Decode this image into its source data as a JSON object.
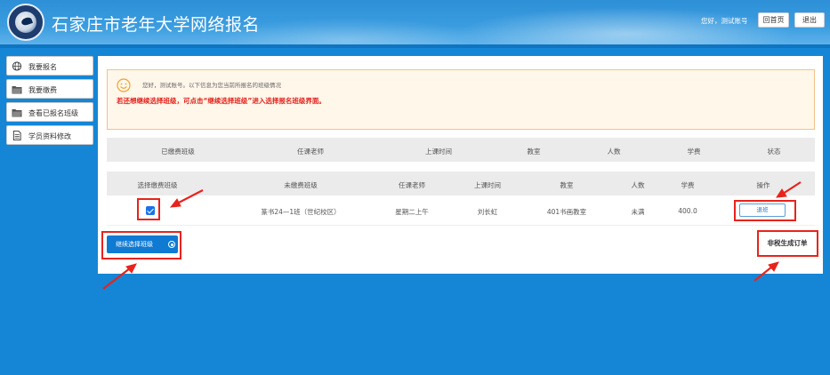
{
  "header": {
    "site_title": "石家庄市老年大学网络报名",
    "greeting": "您好，测试账号",
    "home_label": "回首页",
    "exit_label": "退出"
  },
  "sidebar": {
    "items": [
      {
        "label": "我要报名",
        "icon": "globe-icon"
      },
      {
        "label": "我要缴费",
        "icon": "folder-icon"
      },
      {
        "label": "查看已报名班级",
        "icon": "folder-icon"
      },
      {
        "label": "学员资料修改",
        "icon": "document-icon"
      }
    ]
  },
  "notice": {
    "line1": "您好，测试账号。以下信息为您当前所报名的班级情况",
    "line2": "若还想继续选择班级，可点击“继续选择班级”进入选择报名班级界面。"
  },
  "paid_table": {
    "headers": [
      "已缴费班级",
      "任课老师",
      "上课时间",
      "教室",
      "人数",
      "学费",
      "状态"
    ]
  },
  "unpaid_table": {
    "headers": [
      "选择缴费班级",
      "未缴费班级",
      "任课老师",
      "上课时间",
      "教室",
      "人数",
      "学费",
      "操作"
    ],
    "rows": [
      {
        "selected": true,
        "class": "篆书24—1班（世纪校区）",
        "teacher": "星期二上午",
        "time": "刘长虹",
        "room": "401书画教室",
        "count": "未满",
        "fee": "400.0",
        "action": "退班"
      }
    ]
  },
  "buttons": {
    "continue_label": "继续选择班级",
    "order_label": "非税生成订单"
  },
  "colors": {
    "header_bg": "#3b9de0",
    "page_bg": "#1586d6",
    "notice_text": "#e0201a",
    "primary_button": "#0f7ad1",
    "annotation": "#e8231c"
  }
}
